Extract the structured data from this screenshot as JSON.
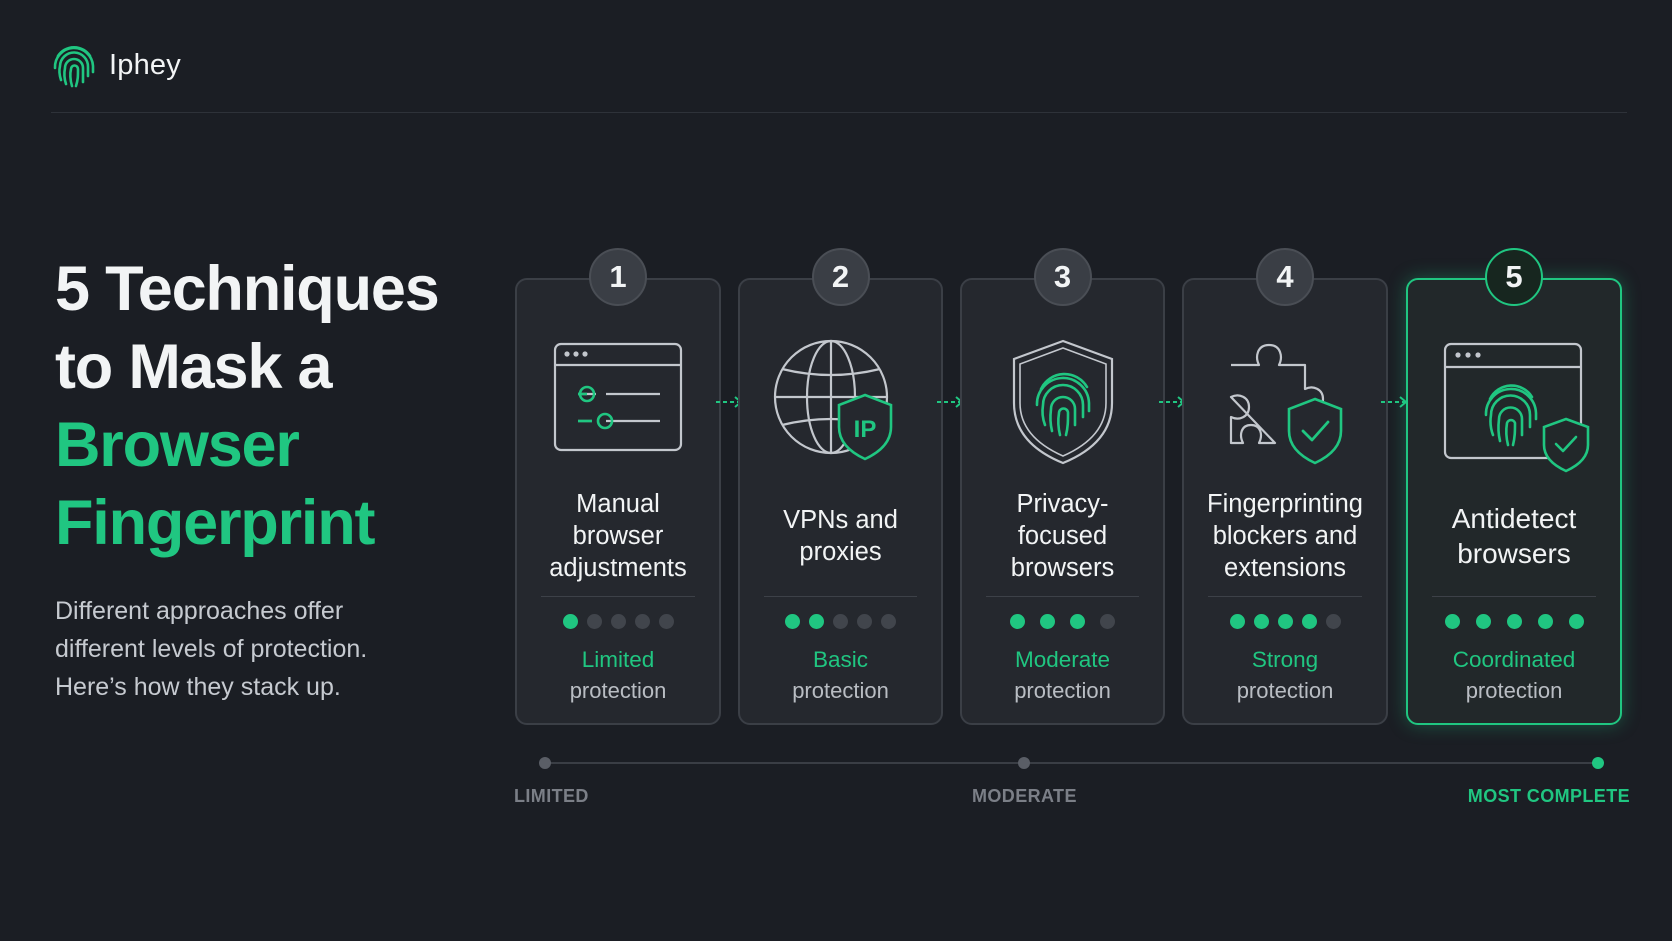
{
  "brand": {
    "name": "Iphey",
    "logo_icon": "fingerprint-icon"
  },
  "hero": {
    "title_lines": [
      "5 Techniques",
      "to Mask a"
    ],
    "title_accent_lines": [
      "Browser",
      "Fingerprint"
    ],
    "subtitle_lines": [
      "Different approaches offer",
      "different levels of protection.",
      "Here’s how they stack up."
    ]
  },
  "colors": {
    "accent": "#20c681",
    "background": "#1b1e24",
    "card": "#25282e",
    "inactive_dot": "#41454c"
  },
  "cards": [
    {
      "number": "1",
      "title": "Manual\nbrowser\nadjustments",
      "icon": "browser-sliders-icon",
      "level": "Limited",
      "suffix": "protection",
      "rating": 1,
      "max_rating": 5
    },
    {
      "number": "2",
      "title": "VPNs and\nproxies",
      "icon": "globe-ip-shield-icon",
      "ip_text": "IP",
      "level": "Basic",
      "suffix": "protection",
      "rating": 2,
      "max_rating": 5
    },
    {
      "number": "3",
      "title": "Privacy-\nfocused\nbrowsers",
      "icon": "fingerprint-shield-icon",
      "level": "Moderate",
      "suffix": "protection",
      "rating": 3,
      "max_rating": 4
    },
    {
      "number": "4",
      "title": "Fingerprinting\nblockers and\nextensions",
      "icon": "puzzle-shield-icon",
      "level": "Strong",
      "suffix": "protection",
      "rating": 4,
      "max_rating": 5
    },
    {
      "number": "5",
      "title": "Antidetect\nbrowsers",
      "icon": "browser-fingerprint-shield-icon",
      "level": "Coordinated",
      "suffix": "protection",
      "rating": 5,
      "max_rating": 5,
      "highlighted": true
    }
  ],
  "scale": {
    "start_label": "LIMITED",
    "mid_label": "MODERATE",
    "end_label": "MOST COMPLETE"
  }
}
